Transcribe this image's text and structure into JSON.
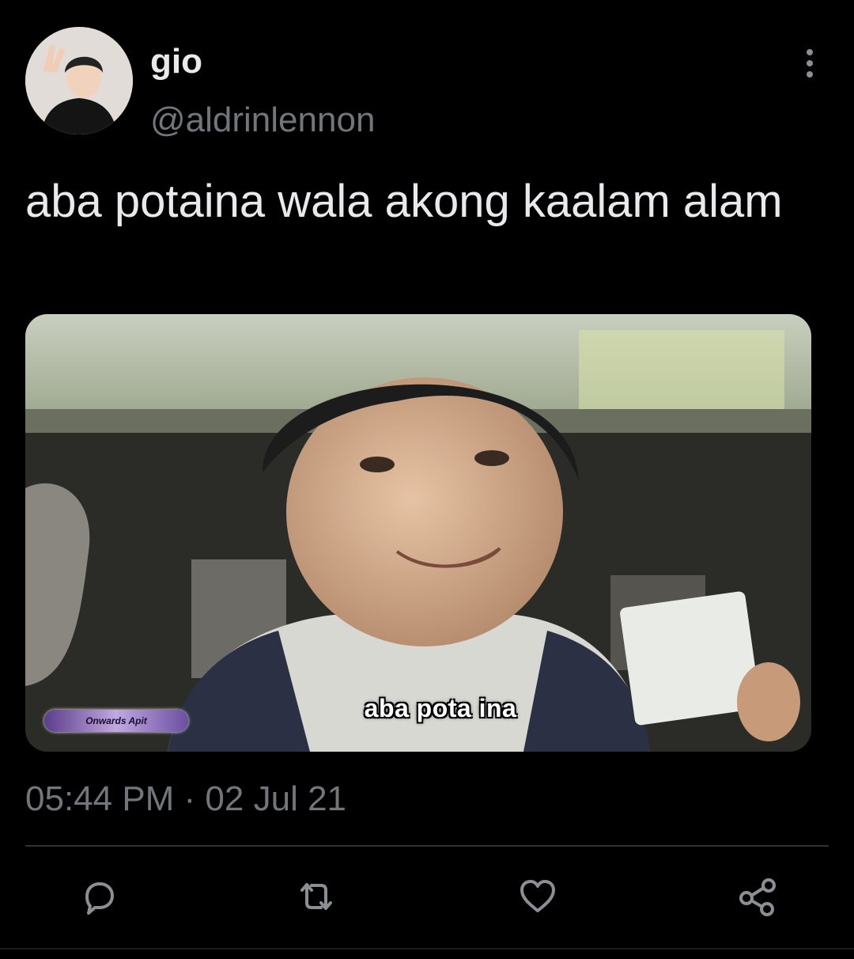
{
  "tweet": {
    "display_name": "gio",
    "handle": "@aldrinlennon",
    "text": "aba potaina wala akong kaalam alam",
    "timestamp": "05:44 PM · 02 Jul 21"
  },
  "media": {
    "caption": "aba pota ina",
    "watermark": "Onwards Apit"
  },
  "actions": {
    "reply": "reply-icon",
    "retweet": "retweet-icon",
    "like": "heart-icon",
    "share": "share-icon"
  },
  "colors": {
    "background": "#000000",
    "primary_text": "#e7e9ea",
    "secondary_text": "#71767b",
    "divider": "#2f3336"
  }
}
